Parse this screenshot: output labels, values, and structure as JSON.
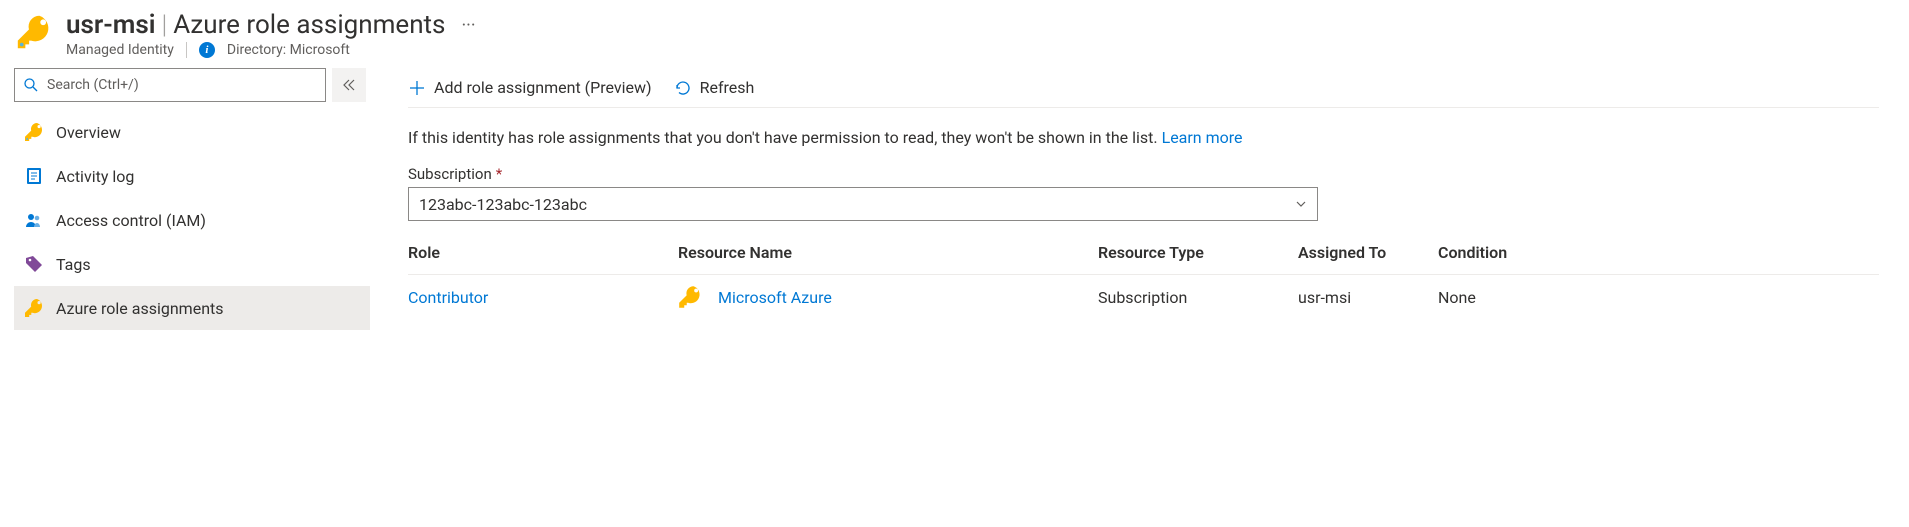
{
  "header": {
    "resource_name": "usr-msi",
    "page_title": "Azure role assignments",
    "resource_type": "Managed Identity",
    "directory_label": "Directory:",
    "directory_value": "Microsoft"
  },
  "sidebar": {
    "search_placeholder": "Search (Ctrl+/)",
    "items": [
      {
        "id": "overview",
        "label": "Overview",
        "icon": "key-icon"
      },
      {
        "id": "activity-log",
        "label": "Activity log",
        "icon": "log-icon"
      },
      {
        "id": "access-control",
        "label": "Access control (IAM)",
        "icon": "people-icon"
      },
      {
        "id": "tags",
        "label": "Tags",
        "icon": "tag-icon"
      },
      {
        "id": "role-assignments",
        "label": "Azure role assignments",
        "icon": "key-icon"
      }
    ]
  },
  "toolbar": {
    "add_label": "Add role assignment (Preview)",
    "refresh_label": "Refresh"
  },
  "info": {
    "text": "If this identity has role assignments that you don't have permission to read, they won't be shown in the list.",
    "learn_more": "Learn more"
  },
  "subscription": {
    "label": "Subscription",
    "value": "123abc-123abc-123abc"
  },
  "table": {
    "columns": [
      "Role",
      "Resource Name",
      "Resource Type",
      "Assigned To",
      "Condition"
    ],
    "rows": [
      {
        "role": "Contributor",
        "resource_name": "Microsoft Azure",
        "resource_type": "Subscription",
        "assigned_to": "usr-msi",
        "condition": "None"
      }
    ]
  }
}
